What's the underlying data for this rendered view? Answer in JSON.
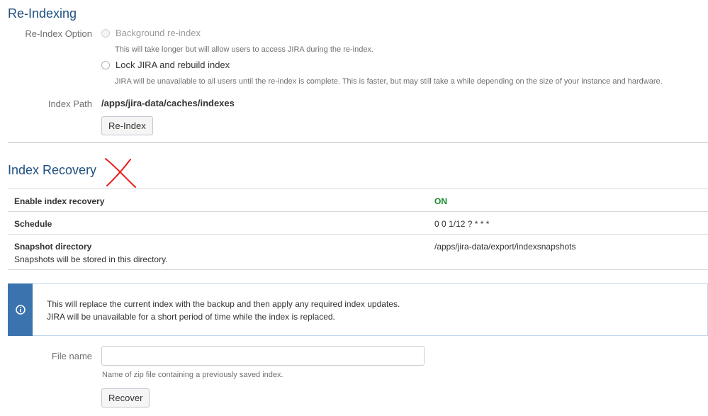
{
  "reindex": {
    "title": "Re-Indexing",
    "option_label": "Re-Index Option",
    "options": [
      {
        "label": "Background re-index",
        "description": "This will take longer but will allow users to access JIRA during the re-index.",
        "disabled": true
      },
      {
        "label": "Lock JIRA and rebuild index",
        "description": "JIRA will be unavailable to all users until the re-index is complete. This is faster, but may still take a while depending on the size of your instance and hardware.",
        "disabled": false
      }
    ],
    "index_path_label": "Index Path",
    "index_path_value": "/apps/jira-data/caches/indexes",
    "button_label": "Re-Index"
  },
  "recovery": {
    "title": "Index Recovery",
    "rows": [
      {
        "label": "Enable index recovery",
        "value": "ON",
        "sub": ""
      },
      {
        "label": "Schedule",
        "value": "0 0 1/12 ? * * *",
        "sub": ""
      },
      {
        "label": "Snapshot directory",
        "value": "/apps/jira-data/export/indexsnapshots",
        "sub": "Snapshots will be stored in this directory."
      }
    ],
    "info_lines": [
      "This will replace the current index with the backup and then apply any required index updates.",
      "JIRA will be unavailable for a short period of time while the index is replaced."
    ],
    "file_name_label": "File name",
    "file_name_value": "",
    "file_name_placeholder": "",
    "file_name_help": "Name of zip file containing a previously saved index.",
    "button_label": "Recover"
  },
  "colors": {
    "heading": "#205081",
    "on_status": "#14892c",
    "info_bar": "#3b73af",
    "annotation_mark": "#e81e1e"
  },
  "icons": {
    "info": "info-circle-icon",
    "annotation": "red-x-mark"
  }
}
